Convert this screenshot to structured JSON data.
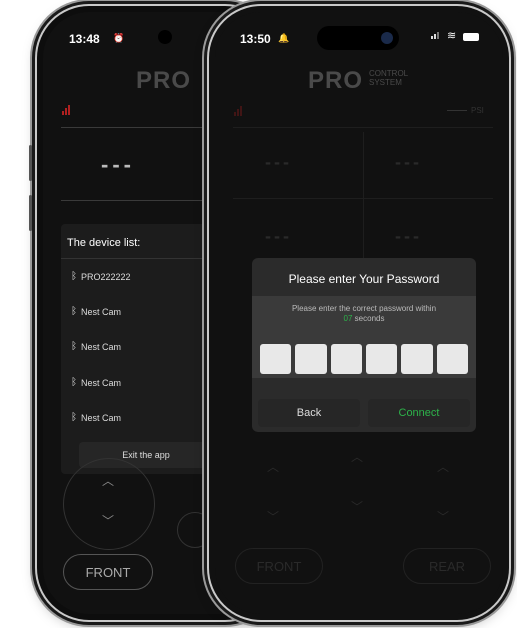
{
  "back_phone": {
    "status_time": "13:48",
    "logo": "PRO",
    "display_value": "---",
    "device_list": {
      "title": "The device list:",
      "items": [
        "PRO222222",
        "Nest Cam",
        "Nest Cam",
        "Nest Cam",
        "Nest Cam"
      ],
      "exit_label": "Exit the app"
    },
    "front_label": "FRONT"
  },
  "front_phone": {
    "status_time": "13:50",
    "logo": "PRO",
    "logo_sub_1": "CONTROL",
    "logo_sub_2": "SYSTEM",
    "psi_label": "PSI",
    "placeholder_value": "---",
    "front_label": "FRONT",
    "rear_label": "REAR"
  },
  "password_dialog": {
    "title": "Please enter Your Password",
    "message_prefix": "Please enter the correct password within",
    "countdown": "07",
    "message_suffix": "seconds",
    "digits": 6,
    "back_label": "Back",
    "connect_label": "Connect",
    "connect_color": "#2db34a"
  },
  "colors": {
    "background": "#0d0d0d",
    "signal": "#b02020",
    "accent": "#2db34a"
  }
}
